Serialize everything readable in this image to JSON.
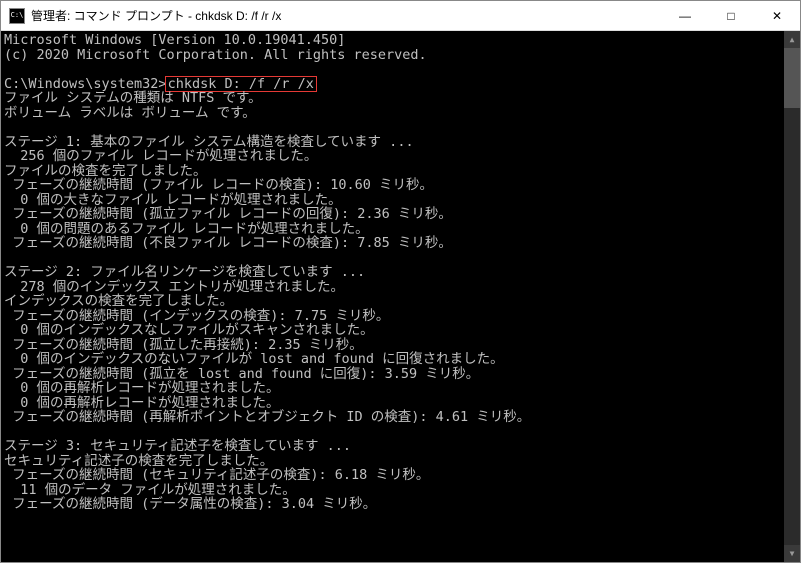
{
  "titlebar": {
    "icon_label": "C:\\",
    "title": "管理者: コマンド プロンプト - chkdsk  D: /f /r /x",
    "minimize": "—",
    "maximize": "□",
    "close": "✕"
  },
  "terminal": {
    "header1": "Microsoft Windows [Version 10.0.19041.450]",
    "header2": "(c) 2020 Microsoft Corporation. All rights reserved.",
    "prompt": "C:\\Windows\\system32>",
    "command": "chkdsk D: /f /r /x",
    "lines": [
      "ファイル システムの種類は NTFS です。",
      "ボリューム ラベルは ボリューム です。",
      "",
      "ステージ 1: 基本のファイル システム構造を検査しています ...",
      "  256 個のファイル レコードが処理されました。",
      "ファイルの検査を完了しました。",
      " フェーズの継続時間 (ファイル レコードの検査): 10.60 ミリ秒。",
      "  0 個の大きなファイル レコードが処理されました。",
      " フェーズの継続時間 (孤立ファイル レコードの回復): 2.36 ミリ秒。",
      "  0 個の問題のあるファイル レコードが処理されました。",
      " フェーズの継続時間 (不良ファイル レコードの検査): 7.85 ミリ秒。",
      "",
      "ステージ 2: ファイル名リンケージを検査しています ...",
      "  278 個のインデックス エントリが処理されました。",
      "インデックスの検査を完了しました。",
      " フェーズの継続時間 (インデックスの検査): 7.75 ミリ秒。",
      "  0 個のインデックスなしファイルがスキャンされました。",
      " フェーズの継続時間 (孤立した再接続): 2.35 ミリ秒。",
      "  0 個のインデックスのないファイルが lost and found に回復されました。",
      " フェーズの継続時間 (孤立を lost and found に回復): 3.59 ミリ秒。",
      "  0 個の再解析レコードが処理されました。",
      "  0 個の再解析レコードが処理されました。",
      " フェーズの継続時間 (再解析ポイントとオブジェクト ID の検査): 4.61 ミリ秒。",
      "",
      "ステージ 3: セキュリティ記述子を検査しています ...",
      "セキュリティ記述子の検査を完了しました。",
      " フェーズの継続時間 (セキュリティ記述子の検査): 6.18 ミリ秒。",
      "  11 個のデータ ファイルが処理されました。",
      " フェーズの継続時間 (データ属性の検査): 3.04 ミリ秒。"
    ]
  },
  "scrollbar": {
    "up": "▲",
    "down": "▼"
  }
}
